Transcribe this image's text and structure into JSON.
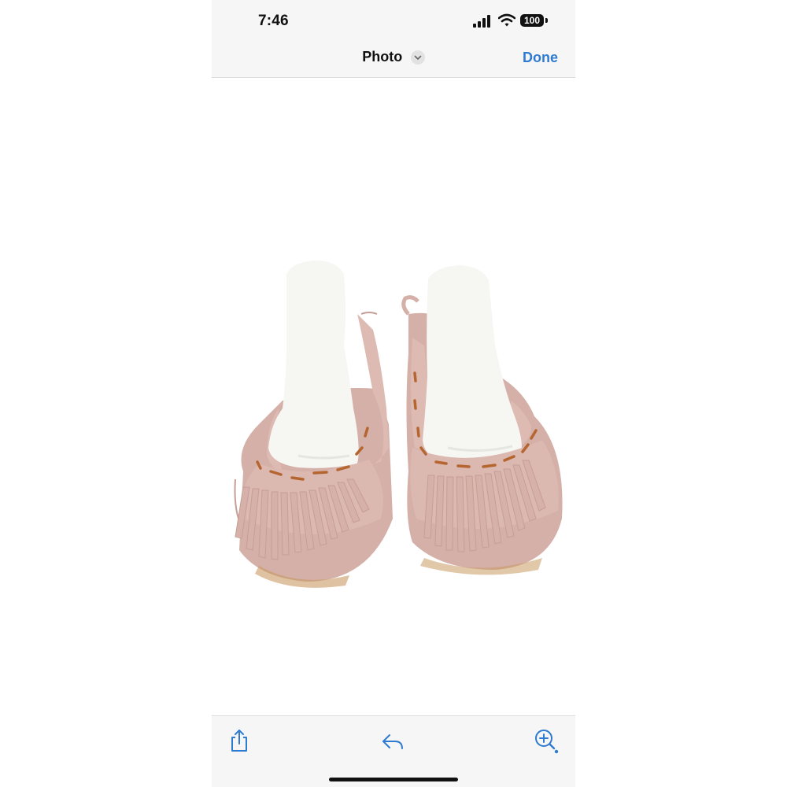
{
  "status_bar": {
    "time": "7:46",
    "battery": "100",
    "icons": [
      "cellular-signal-icon",
      "wifi-icon",
      "battery-icon"
    ]
  },
  "nav": {
    "title": "Photo",
    "title_chevron_icon": "chevron-down-icon",
    "done_label": "Done"
  },
  "toolbar": {
    "icons": [
      "share-icon",
      "reply-icon",
      "zoom-in-icon"
    ]
  },
  "colors": {
    "accent": "#2f7bd1",
    "bar_background": "#f6f6f6",
    "moccasin_suede": "#d9b7b0",
    "stitching": "#b5652f",
    "mannequin": "#f7f7f4"
  }
}
